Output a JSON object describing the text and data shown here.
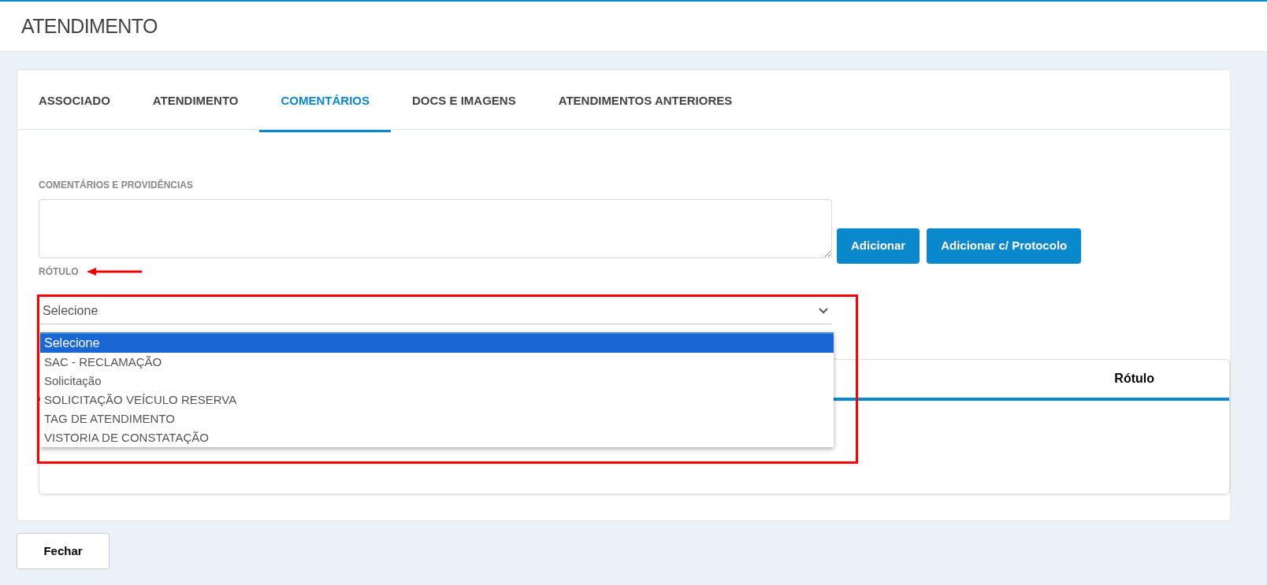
{
  "header": {
    "title": "ATENDIMENTO"
  },
  "tabs": [
    {
      "label": "ASSOCIADO",
      "selected": false
    },
    {
      "label": "ATENDIMENTO",
      "selected": false
    },
    {
      "label": "COMENTÁRIOS",
      "selected": true
    },
    {
      "label": "DOCS E IMAGENS",
      "selected": false
    },
    {
      "label": "ATENDIMENTOS ANTERIORES",
      "selected": false
    }
  ],
  "comments": {
    "label": "COMENTÁRIOS E PROVIDÊNCIAS",
    "buttons": [
      "Adicionar",
      "Adicionar c/ Protocolo"
    ]
  },
  "label_select": {
    "label": "RÓTULO",
    "value": "Selecione",
    "expanded": true,
    "options": [
      {
        "label": "Selecione",
        "selected": true
      },
      {
        "label": "SAC - RECLAMAÇÃO",
        "selected": false
      },
      {
        "label": "Solicitação",
        "selected": false
      },
      {
        "label": "SOLICITAÇÃO VEÍCULO RESERVA",
        "selected": false
      },
      {
        "label": "TAG DE ATENDIMENTO",
        "selected": false
      },
      {
        "label": "VISTORIA DE CONSTATAÇÃO",
        "selected": false
      }
    ]
  },
  "table": {
    "columns": [
      "Rótulo"
    ]
  },
  "footer": {
    "button": "Fechar"
  }
}
